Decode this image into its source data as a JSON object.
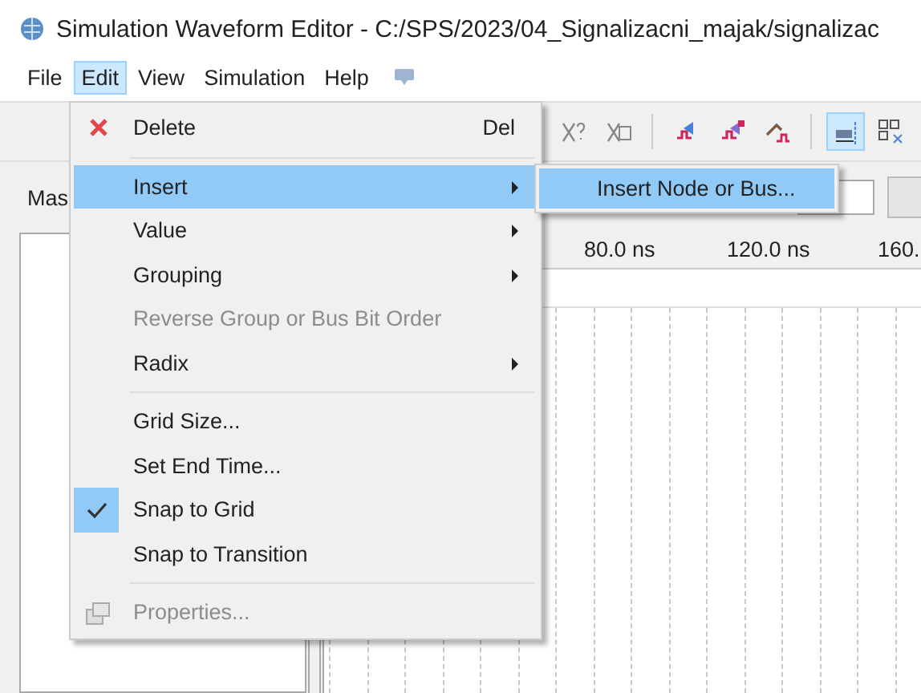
{
  "window": {
    "title": "Simulation Waveform Editor - C:/SPS/2023/04_Signalizacni_majak/signalizac"
  },
  "menu_bar": [
    {
      "label": "File",
      "selected": false
    },
    {
      "label": "Edit",
      "selected": true
    },
    {
      "label": "View",
      "selected": false
    },
    {
      "label": "Simulation",
      "selected": false
    },
    {
      "label": "Help",
      "selected": false
    }
  ],
  "toolbar": [
    {
      "kind": "unknown",
      "selected": false
    },
    {
      "kind": "random",
      "selected": false
    },
    {
      "kind": "separator"
    },
    {
      "kind": "count-blue",
      "selected": false
    },
    {
      "kind": "count-red",
      "selected": false
    },
    {
      "kind": "clock",
      "selected": false
    },
    {
      "kind": "separator"
    },
    {
      "kind": "snap",
      "selected": true
    },
    {
      "kind": "grid",
      "selected": false
    }
  ],
  "master_label": "Mas",
  "timeline": {
    "ticks": [
      "80.0 ns",
      "120.0 ns",
      "160."
    ]
  },
  "edit_menu": {
    "items": [
      {
        "kind": "delete",
        "label": "Delete",
        "shortcut": "Del",
        "disabled": false,
        "selected": false,
        "checked": false,
        "submenu": false
      },
      {
        "kind": "separator"
      },
      {
        "kind": "command",
        "label": "Insert",
        "disabled": false,
        "selected": true,
        "checked": false,
        "submenu": true
      },
      {
        "kind": "command",
        "label": "Value",
        "disabled": false,
        "selected": false,
        "checked": false,
        "submenu": true
      },
      {
        "kind": "command",
        "label": "Grouping",
        "disabled": false,
        "selected": false,
        "checked": false,
        "submenu": true
      },
      {
        "kind": "command",
        "label": "Reverse Group or Bus Bit Order",
        "disabled": true,
        "selected": false,
        "checked": false,
        "submenu": false
      },
      {
        "kind": "command",
        "label": "Radix",
        "disabled": false,
        "selected": false,
        "checked": false,
        "submenu": true
      },
      {
        "kind": "separator"
      },
      {
        "kind": "command",
        "label": "Grid Size...",
        "disabled": false,
        "selected": false,
        "checked": false,
        "submenu": false
      },
      {
        "kind": "command",
        "label": "Set End Time...",
        "disabled": false,
        "selected": false,
        "checked": false,
        "submenu": false
      },
      {
        "kind": "command",
        "label": "Snap to Grid",
        "disabled": false,
        "selected": false,
        "checked": true,
        "submenu": false
      },
      {
        "kind": "command",
        "label": "Snap to Transition",
        "disabled": false,
        "selected": false,
        "checked": false,
        "submenu": false
      },
      {
        "kind": "separator"
      },
      {
        "kind": "properties",
        "label": "Properties...",
        "disabled": true,
        "selected": false,
        "checked": false,
        "submenu": false
      }
    ]
  },
  "insert_submenu": {
    "items": [
      {
        "label": "Insert Node or Bus...",
        "selected": true
      }
    ]
  }
}
